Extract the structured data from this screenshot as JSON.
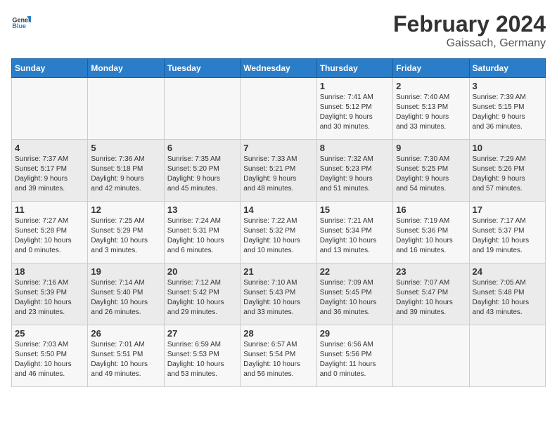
{
  "header": {
    "logo_general": "General",
    "logo_blue": "Blue",
    "main_title": "February 2024",
    "subtitle": "Gaissach, Germany"
  },
  "days_of_week": [
    "Sunday",
    "Monday",
    "Tuesday",
    "Wednesday",
    "Thursday",
    "Friday",
    "Saturday"
  ],
  "weeks": [
    [
      {
        "day": "",
        "info": ""
      },
      {
        "day": "",
        "info": ""
      },
      {
        "day": "",
        "info": ""
      },
      {
        "day": "",
        "info": ""
      },
      {
        "day": "1",
        "info": "Sunrise: 7:41 AM\nSunset: 5:12 PM\nDaylight: 9 hours\nand 30 minutes."
      },
      {
        "day": "2",
        "info": "Sunrise: 7:40 AM\nSunset: 5:13 PM\nDaylight: 9 hours\nand 33 minutes."
      },
      {
        "day": "3",
        "info": "Sunrise: 7:39 AM\nSunset: 5:15 PM\nDaylight: 9 hours\nand 36 minutes."
      }
    ],
    [
      {
        "day": "4",
        "info": "Sunrise: 7:37 AM\nSunset: 5:17 PM\nDaylight: 9 hours\nand 39 minutes."
      },
      {
        "day": "5",
        "info": "Sunrise: 7:36 AM\nSunset: 5:18 PM\nDaylight: 9 hours\nand 42 minutes."
      },
      {
        "day": "6",
        "info": "Sunrise: 7:35 AM\nSunset: 5:20 PM\nDaylight: 9 hours\nand 45 minutes."
      },
      {
        "day": "7",
        "info": "Sunrise: 7:33 AM\nSunset: 5:21 PM\nDaylight: 9 hours\nand 48 minutes."
      },
      {
        "day": "8",
        "info": "Sunrise: 7:32 AM\nSunset: 5:23 PM\nDaylight: 9 hours\nand 51 minutes."
      },
      {
        "day": "9",
        "info": "Sunrise: 7:30 AM\nSunset: 5:25 PM\nDaylight: 9 hours\nand 54 minutes."
      },
      {
        "day": "10",
        "info": "Sunrise: 7:29 AM\nSunset: 5:26 PM\nDaylight: 9 hours\nand 57 minutes."
      }
    ],
    [
      {
        "day": "11",
        "info": "Sunrise: 7:27 AM\nSunset: 5:28 PM\nDaylight: 10 hours\nand 0 minutes."
      },
      {
        "day": "12",
        "info": "Sunrise: 7:25 AM\nSunset: 5:29 PM\nDaylight: 10 hours\nand 3 minutes."
      },
      {
        "day": "13",
        "info": "Sunrise: 7:24 AM\nSunset: 5:31 PM\nDaylight: 10 hours\nand 6 minutes."
      },
      {
        "day": "14",
        "info": "Sunrise: 7:22 AM\nSunset: 5:32 PM\nDaylight: 10 hours\nand 10 minutes."
      },
      {
        "day": "15",
        "info": "Sunrise: 7:21 AM\nSunset: 5:34 PM\nDaylight: 10 hours\nand 13 minutes."
      },
      {
        "day": "16",
        "info": "Sunrise: 7:19 AM\nSunset: 5:36 PM\nDaylight: 10 hours\nand 16 minutes."
      },
      {
        "day": "17",
        "info": "Sunrise: 7:17 AM\nSunset: 5:37 PM\nDaylight: 10 hours\nand 19 minutes."
      }
    ],
    [
      {
        "day": "18",
        "info": "Sunrise: 7:16 AM\nSunset: 5:39 PM\nDaylight: 10 hours\nand 23 minutes."
      },
      {
        "day": "19",
        "info": "Sunrise: 7:14 AM\nSunset: 5:40 PM\nDaylight: 10 hours\nand 26 minutes."
      },
      {
        "day": "20",
        "info": "Sunrise: 7:12 AM\nSunset: 5:42 PM\nDaylight: 10 hours\nand 29 minutes."
      },
      {
        "day": "21",
        "info": "Sunrise: 7:10 AM\nSunset: 5:43 PM\nDaylight: 10 hours\nand 33 minutes."
      },
      {
        "day": "22",
        "info": "Sunrise: 7:09 AM\nSunset: 5:45 PM\nDaylight: 10 hours\nand 36 minutes."
      },
      {
        "day": "23",
        "info": "Sunrise: 7:07 AM\nSunset: 5:47 PM\nDaylight: 10 hours\nand 39 minutes."
      },
      {
        "day": "24",
        "info": "Sunrise: 7:05 AM\nSunset: 5:48 PM\nDaylight: 10 hours\nand 43 minutes."
      }
    ],
    [
      {
        "day": "25",
        "info": "Sunrise: 7:03 AM\nSunset: 5:50 PM\nDaylight: 10 hours\nand 46 minutes."
      },
      {
        "day": "26",
        "info": "Sunrise: 7:01 AM\nSunset: 5:51 PM\nDaylight: 10 hours\nand 49 minutes."
      },
      {
        "day": "27",
        "info": "Sunrise: 6:59 AM\nSunset: 5:53 PM\nDaylight: 10 hours\nand 53 minutes."
      },
      {
        "day": "28",
        "info": "Sunrise: 6:57 AM\nSunset: 5:54 PM\nDaylight: 10 hours\nand 56 minutes."
      },
      {
        "day": "29",
        "info": "Sunrise: 6:56 AM\nSunset: 5:56 PM\nDaylight: 11 hours\nand 0 minutes."
      },
      {
        "day": "",
        "info": ""
      },
      {
        "day": "",
        "info": ""
      }
    ]
  ]
}
